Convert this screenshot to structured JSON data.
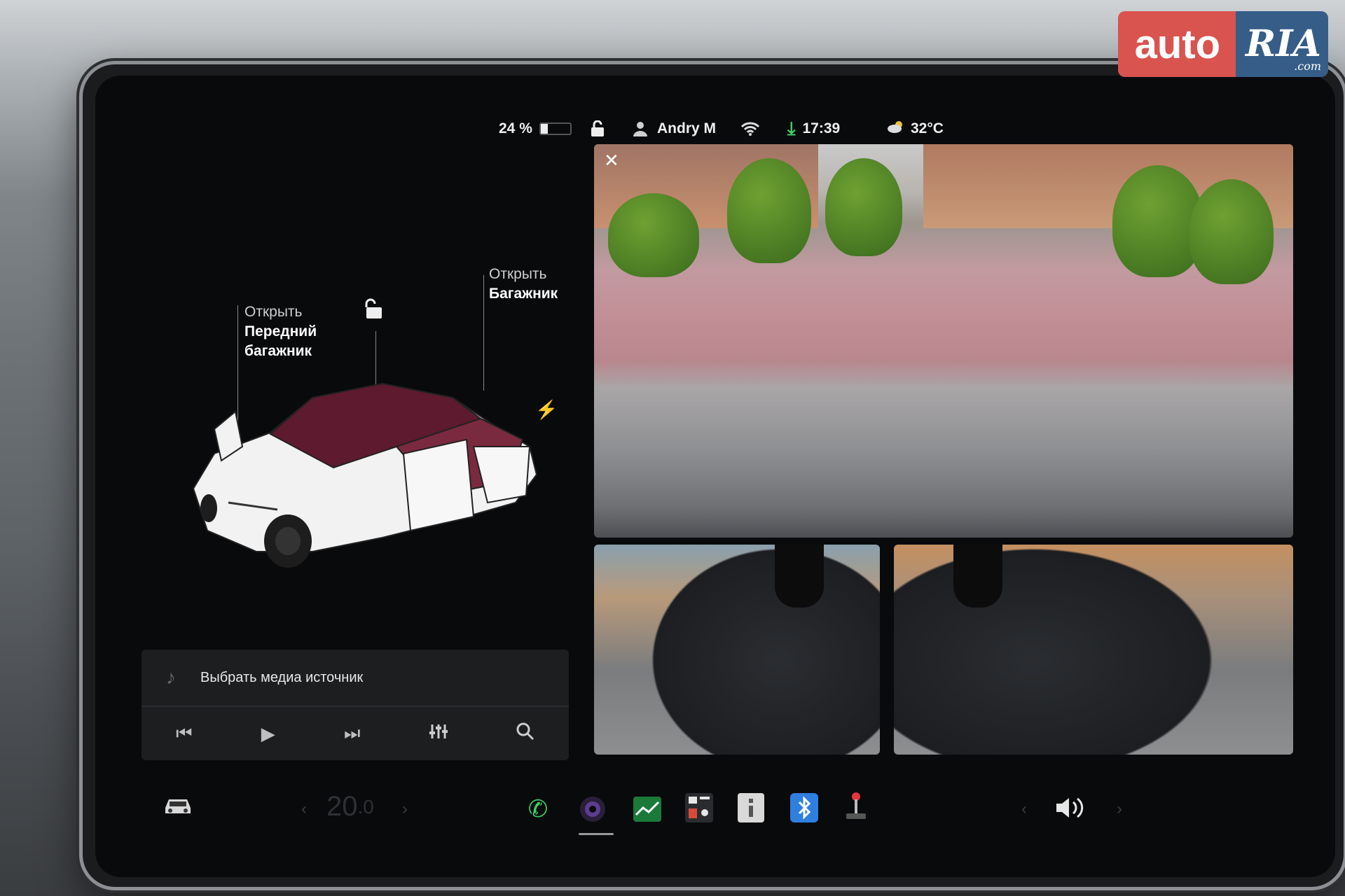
{
  "watermark": {
    "auto": "auto",
    "ria": "RIA",
    "dotcom": ".com"
  },
  "status": {
    "battery": "24 %",
    "battery_level": 0.24,
    "user": "Andry M",
    "time": "17:39",
    "temperature": "32°C"
  },
  "car": {
    "frunk_label_1": "Открыть",
    "frunk_label_2": "Передний",
    "frunk_label_3": "багажник",
    "trunk_label_1": "Открыть",
    "trunk_label_2": "Багажник",
    "car_color": "#5e1a2e"
  },
  "media": {
    "source_label": "Выбрать медиа источник"
  },
  "dock": {
    "cabin_temp_main": "20",
    "cabin_temp_decimal": ".0"
  },
  "icons": {
    "battery": "battery-icon",
    "lock": "unlock-icon",
    "user": "user-icon",
    "wifi": "wifi-icon",
    "download": "download-icon",
    "weather": "cloud-sun-icon",
    "charge": "lightning-icon",
    "phone": "phone-icon",
    "camera": "camera-icon",
    "energy": "energy-chart-icon",
    "calendar": "calendar-icon",
    "manual": "manual-icon",
    "bluetooth": "bluetooth-icon",
    "toybox": "joystick-icon",
    "volume": "volume-icon",
    "car": "car-icon"
  }
}
